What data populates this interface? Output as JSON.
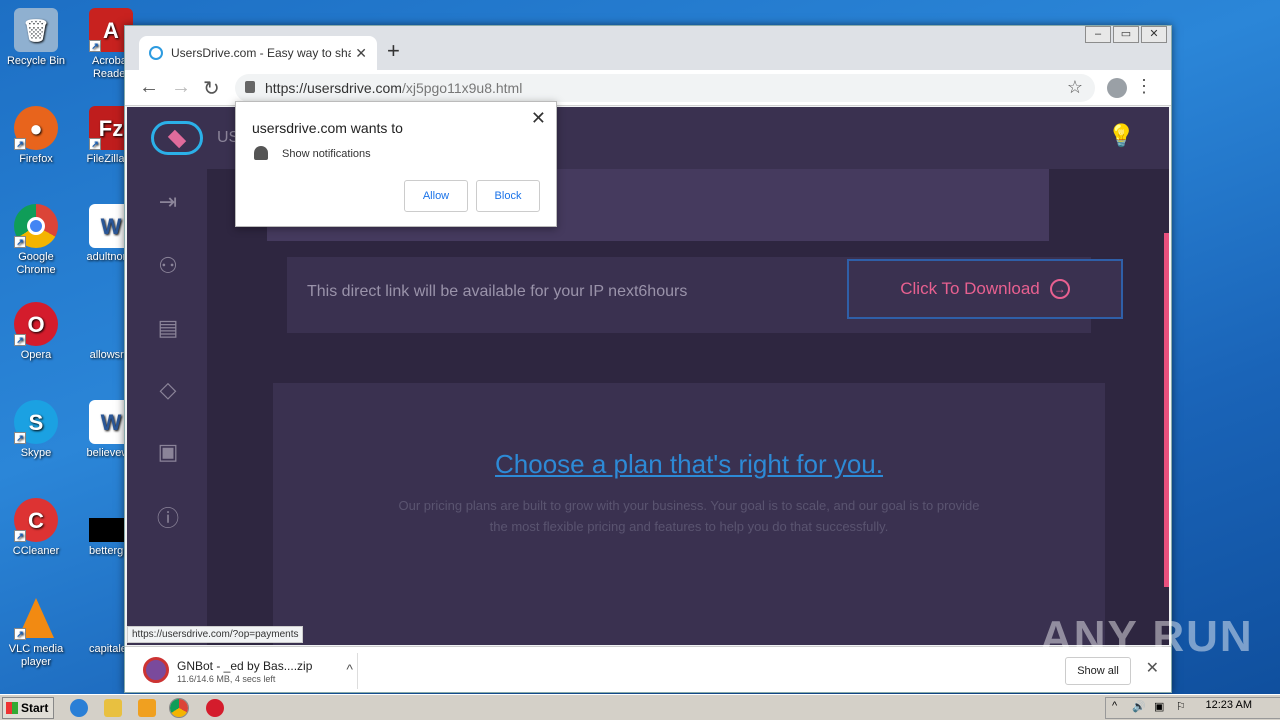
{
  "desktop": {
    "icons": [
      {
        "label": "Recycle Bin",
        "icon": "recycle-bin-icon",
        "color": "#8fb0d0"
      },
      {
        "label": "Acrobat Reader",
        "icon": "acrobat-icon",
        "color": "#c8221f"
      },
      {
        "label": "Firefox",
        "icon": "firefox-icon",
        "color": "#e8641c"
      },
      {
        "label": "FileZilla C",
        "icon": "filezilla-icon",
        "color": "#bf1d1d"
      },
      {
        "label": "Google Chrome",
        "icon": "chrome-icon",
        "color": "#3d8be8"
      },
      {
        "label": "adultnorm",
        "icon": "word-doc-icon",
        "color": "#2b5797"
      },
      {
        "label": "Opera",
        "icon": "opera-icon",
        "color": "#d41c2c"
      },
      {
        "label": "allowsr.p",
        "icon": "file-icon",
        "color": "#1a64b8"
      },
      {
        "label": "Skype",
        "icon": "skype-icon",
        "color": "#1ba1e2"
      },
      {
        "label": "believewe",
        "icon": "word-doc-icon",
        "color": "#2b5797"
      },
      {
        "label": "CCleaner",
        "icon": "ccleaner-icon",
        "color": "#d33"
      },
      {
        "label": "bettergro",
        "icon": "black-file-icon",
        "color": "#000000"
      },
      {
        "label": "VLC media player",
        "icon": "vlc-icon",
        "color": "#f28a12"
      },
      {
        "label": "capitaled",
        "icon": "file-icon",
        "color": "#1a64b8"
      }
    ]
  },
  "browser": {
    "tab_title": "UsersDrive.com - Easy way to share",
    "url_host": "https://usersdrive.com",
    "url_path": "/xj5pgo11x9u8.html",
    "status_url": "https://usersdrive.com/?op=payments"
  },
  "site": {
    "brand": "US",
    "notice_text": "This direct link will be available for your IP next6hours",
    "download_label": "Click To Download",
    "plan_title": "Choose a plan that's right for you.",
    "plan_desc": "Our pricing plans are built to grow with your business. Your goal is to scale, and our goal is to provide the most flexible pricing and features to help you do that successfully."
  },
  "permission": {
    "title": "usersdrive.com wants to",
    "label": "Show notifications",
    "allow": "Allow",
    "block": "Block"
  },
  "download_shelf": {
    "file_name": "GNBot - _ed by Bas....zip",
    "progress": "11.6/14.6 MB, 4 secs left",
    "show_all": "Show all"
  },
  "watermark": "ANY RUN",
  "taskbar": {
    "start": "Start",
    "clock": "12:23 AM"
  }
}
